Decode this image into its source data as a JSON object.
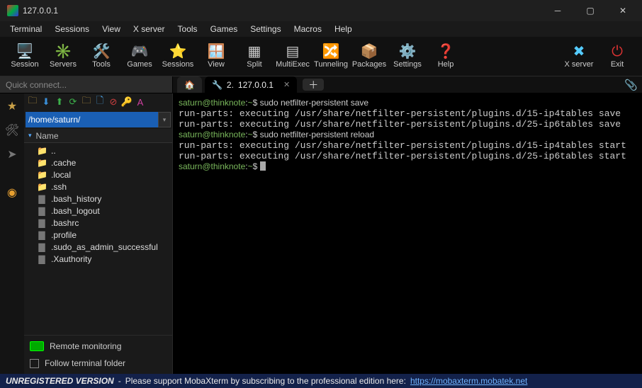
{
  "window": {
    "title": "127.0.0.1"
  },
  "menu": [
    "Terminal",
    "Sessions",
    "View",
    "X server",
    "Tools",
    "Games",
    "Settings",
    "Macros",
    "Help"
  ],
  "toolbar": [
    {
      "name": "session",
      "label": "Session",
      "icon": "🖥️"
    },
    {
      "name": "servers",
      "label": "Servers",
      "icon": "✳️"
    },
    {
      "name": "tools",
      "label": "Tools",
      "icon": "🛠️"
    },
    {
      "name": "games",
      "label": "Games",
      "icon": "🎮"
    },
    {
      "name": "sessions",
      "label": "Sessions",
      "icon": "⭐"
    },
    {
      "name": "view",
      "label": "View",
      "icon": "🪟"
    },
    {
      "name": "split",
      "label": "Split",
      "icon": "▦"
    },
    {
      "name": "multiexec",
      "label": "MultiExec",
      "icon": "▤"
    },
    {
      "name": "tunneling",
      "label": "Tunneling",
      "icon": "🔀"
    },
    {
      "name": "packages",
      "label": "Packages",
      "icon": "📦"
    },
    {
      "name": "settings",
      "label": "Settings",
      "icon": "⚙️"
    },
    {
      "name": "help",
      "label": "Help",
      "icon": "❓"
    }
  ],
  "toolbar_right": [
    {
      "name": "xserver",
      "label": "X server",
      "icon": "✖",
      "color": "#5cf"
    },
    {
      "name": "exit",
      "label": "Exit",
      "icon": "⏻",
      "color": "#d33"
    }
  ],
  "quick_connect_placeholder": "Quick connect...",
  "tabs": {
    "home_icon": "🏠",
    "active": {
      "index": "2.",
      "label": "127.0.0.1",
      "icon": "🔧"
    }
  },
  "sidebar": {
    "path": "/home/saturn/",
    "column": "Name",
    "items": [
      {
        "name": "..",
        "type": "up",
        "icon": "📁",
        "cls": "foldg"
      },
      {
        "name": ".cache",
        "type": "folder",
        "icon": "📁",
        "cls": "fold"
      },
      {
        "name": ".local",
        "type": "folder",
        "icon": "📁",
        "cls": "fold"
      },
      {
        "name": ".ssh",
        "type": "folder",
        "icon": "📁",
        "cls": "fold"
      },
      {
        "name": ".bash_history",
        "type": "file",
        "icon": "▇",
        "cls": "fileg"
      },
      {
        "name": ".bash_logout",
        "type": "file",
        "icon": "▇",
        "cls": "fileg"
      },
      {
        "name": ".bashrc",
        "type": "file",
        "icon": "▇",
        "cls": "fileg"
      },
      {
        "name": ".profile",
        "type": "file",
        "icon": "▇",
        "cls": "fileg"
      },
      {
        "name": ".sudo_as_admin_successful",
        "type": "file",
        "icon": "▇",
        "cls": "fileg"
      },
      {
        "name": ".Xauthority",
        "type": "file",
        "icon": "▇",
        "cls": "fileg"
      }
    ],
    "remote_monitoring": "Remote monitoring",
    "follow_terminal": "Follow terminal folder"
  },
  "terminal_lines": [
    {
      "p": "saturn@thinknote",
      "s": ":",
      "d": "~",
      "e": "$ ",
      "c": "sudo netfilter-persistent save"
    },
    {
      "t": "run-parts: executing /usr/share/netfilter-persistent/plugins.d/15-ip4tables save"
    },
    {
      "t": "run-parts: executing /usr/share/netfilter-persistent/plugins.d/25-ip6tables save"
    },
    {
      "p": "saturn@thinknote",
      "s": ":",
      "d": "~",
      "e": "$ ",
      "c": "sudo netfilter-persistent reload"
    },
    {
      "t": "run-parts: executing /usr/share/netfilter-persistent/plugins.d/15-ip4tables start"
    },
    {
      "t": "run-parts: executing /usr/share/netfilter-persistent/plugins.d/25-ip6tables start"
    },
    {
      "p": "saturn@thinknote",
      "s": ":",
      "d": "~",
      "e": "$ ",
      "cursor": true
    }
  ],
  "status": {
    "unreg": "UNREGISTERED VERSION",
    "msg": "Please support MobaXterm by subscribing to the professional edition here:",
    "link": "https://mobaxterm.mobatek.net"
  }
}
